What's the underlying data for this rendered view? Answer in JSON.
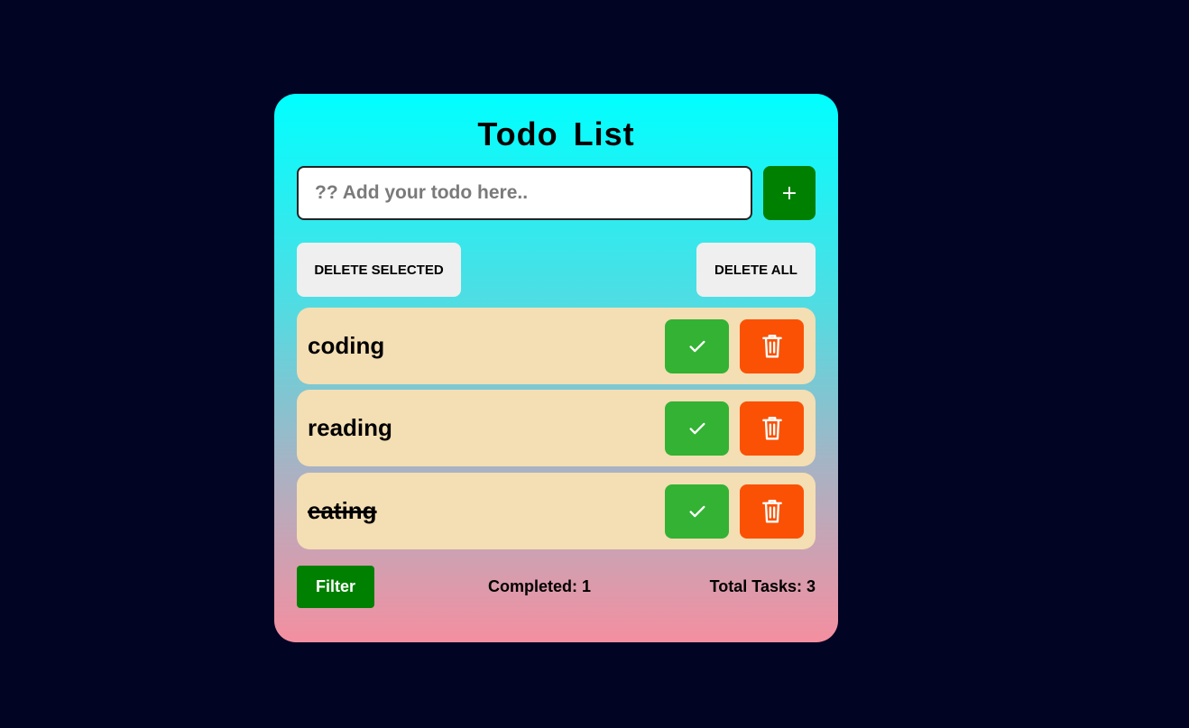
{
  "title": "Todo List",
  "input": {
    "placeholder": "?? Add your todo here..",
    "value": ""
  },
  "add_button": {
    "label": "+"
  },
  "actions": {
    "delete_selected": "DELETE SELECTED",
    "delete_all": "DELETE ALL"
  },
  "todos": [
    {
      "text": "coding",
      "completed": false
    },
    {
      "text": "reading",
      "completed": false
    },
    {
      "text": "eating",
      "completed": true
    }
  ],
  "icons": {
    "complete": "check-icon",
    "delete": "trash-icon"
  },
  "footer": {
    "filter_label": "Filter",
    "completed_text": "Completed: 1",
    "total_text": "Total Tasks: 3"
  },
  "colors": {
    "background": "#020424",
    "gradient_top": "#00ffff",
    "gradient_bottom": "#f48fa0",
    "add_button": "#008000",
    "item_background": "#f4deb3",
    "check_button": "#33b233",
    "delete_button": "#fb5104",
    "neutral_button": "#efefef"
  }
}
